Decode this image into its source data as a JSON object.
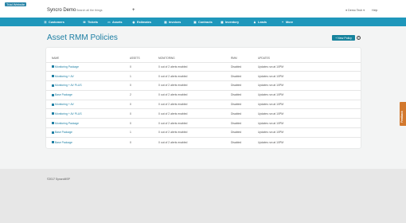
{
  "topbar": {
    "badge": "Trial Website",
    "brand": "Syncro Demo",
    "search_placeholder": "Search all the things",
    "plus": "+",
    "user": "Demo Tech",
    "user_caret": "▾",
    "help": "Help"
  },
  "nav": [
    {
      "label": "Customers",
      "icon": "users-icon",
      "glyph": "☰"
    },
    {
      "label": "Tickets",
      "icon": "ticket-icon",
      "glyph": "✉"
    },
    {
      "label": "Assets",
      "icon": "monitor-icon",
      "glyph": "▭"
    },
    {
      "label": "Estimates",
      "icon": "estimate-icon",
      "glyph": "◉"
    },
    {
      "label": "Invoices",
      "icon": "invoice-icon",
      "glyph": "▤"
    },
    {
      "label": "Contracts",
      "icon": "contract-icon",
      "glyph": "▣"
    },
    {
      "label": "Inventory",
      "icon": "inventory-icon",
      "glyph": "▦"
    },
    {
      "label": "Leads",
      "icon": "leads-icon",
      "glyph": "♟"
    },
    {
      "label": "More",
      "icon": "plus-icon",
      "glyph": "+"
    }
  ],
  "page": {
    "title": "Asset RMM Policies",
    "new_button": "+ New Policy",
    "help_glyph": "?"
  },
  "table": {
    "headers": [
      "NAME",
      "ASSETS",
      "MONITORING",
      "RMM",
      "UPDATES"
    ],
    "rows": [
      {
        "name": "Monitoring Package",
        "assets": "0",
        "monitoring": "0 out of 2 alerts enabled",
        "rmm": "Disabled",
        "updates": "Updates run at 10PM"
      },
      {
        "name": "Monitoring + AV",
        "assets": "1",
        "monitoring": "0 out of 2 alerts enabled",
        "rmm": "Disabled",
        "updates": "Updates run at 10PM"
      },
      {
        "name": "Monitoring + AV PLUS",
        "assets": "0",
        "monitoring": "0 out of 2 alerts enabled",
        "rmm": "Disabled",
        "updates": "Updates run at 10PM"
      },
      {
        "name": "Base Package",
        "assets": "2",
        "monitoring": "0 out of 2 alerts enabled",
        "rmm": "Disabled",
        "updates": "Updates run at 10PM"
      },
      {
        "name": "Monitoring + AV",
        "assets": "0",
        "monitoring": "0 out of 2 alerts enabled",
        "rmm": "Disabled",
        "updates": "Updates run at 10PM"
      },
      {
        "name": "Monitoring + AV PLUS",
        "assets": "0",
        "monitoring": "0 out of 2 alerts enabled",
        "rmm": "Disabled",
        "updates": "Updates run at 10PM"
      },
      {
        "name": "Monitoring Package",
        "assets": "0",
        "monitoring": "0 out of 2 alerts enabled",
        "rmm": "Disabled",
        "updates": "Updates run at 10PM"
      },
      {
        "name": "Base Package",
        "assets": "1",
        "monitoring": "0 out of 2 alerts enabled",
        "rmm": "Disabled",
        "updates": "Updates run at 10PM"
      },
      {
        "name": "Base Package",
        "assets": "0",
        "monitoring": "0 out of 2 alerts enabled",
        "rmm": "Disabled",
        "updates": "Updates run at 10PM"
      }
    ]
  },
  "feedback": "Feedback",
  "footer": {
    "copyright": "©2017 SyncroMSP"
  },
  "colors": {
    "nav_bg": "#1f97bb",
    "accent": "#1c7ea3",
    "feedback": "#d2782d"
  }
}
